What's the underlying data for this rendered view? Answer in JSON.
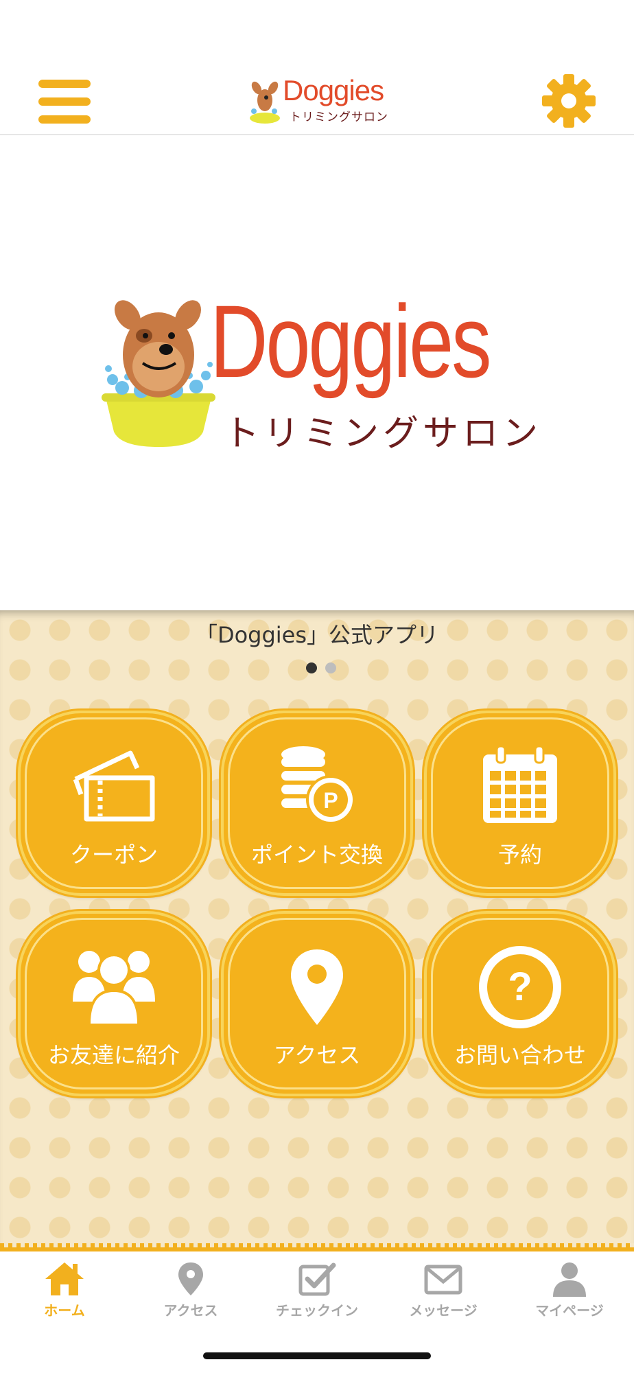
{
  "header": {
    "logo_title": "Doggies",
    "logo_subtitle": "トリミングサロン",
    "menu_icon": "hamburger-icon",
    "settings_icon": "gear-icon"
  },
  "hero": {
    "title": "Doggies",
    "subtitle": "トリミングサロン"
  },
  "main": {
    "caption": "「Doggies」公式アプリ",
    "carousel": {
      "pages": 2,
      "active": 1
    },
    "tiles": [
      {
        "label": "クーポン",
        "icon": "ticket-icon"
      },
      {
        "label": "ポイント交換",
        "icon": "coins-icon"
      },
      {
        "label": "予約",
        "icon": "calendar-icon"
      },
      {
        "label": "お友達に紹介",
        "icon": "people-icon"
      },
      {
        "label": "アクセス",
        "icon": "map-pin-icon"
      },
      {
        "label": "お問い合わせ",
        "icon": "question-icon"
      }
    ]
  },
  "tabbar": {
    "tabs": [
      {
        "label": "ホーム",
        "icon": "home-icon",
        "active": true
      },
      {
        "label": "アクセス",
        "icon": "map-pin-icon",
        "active": false
      },
      {
        "label": "チェックイン",
        "icon": "checkbox-icon",
        "active": false
      },
      {
        "label": "メッセージ",
        "icon": "envelope-icon",
        "active": false
      },
      {
        "label": "マイページ",
        "icon": "user-icon",
        "active": false
      }
    ]
  },
  "colors": {
    "accent": "#f2b01e",
    "logo_red": "#e24b2a",
    "logo_brown": "#6b1d1d",
    "background_cream": "#f6e8c8",
    "inactive_gray": "#a7a7a7"
  }
}
